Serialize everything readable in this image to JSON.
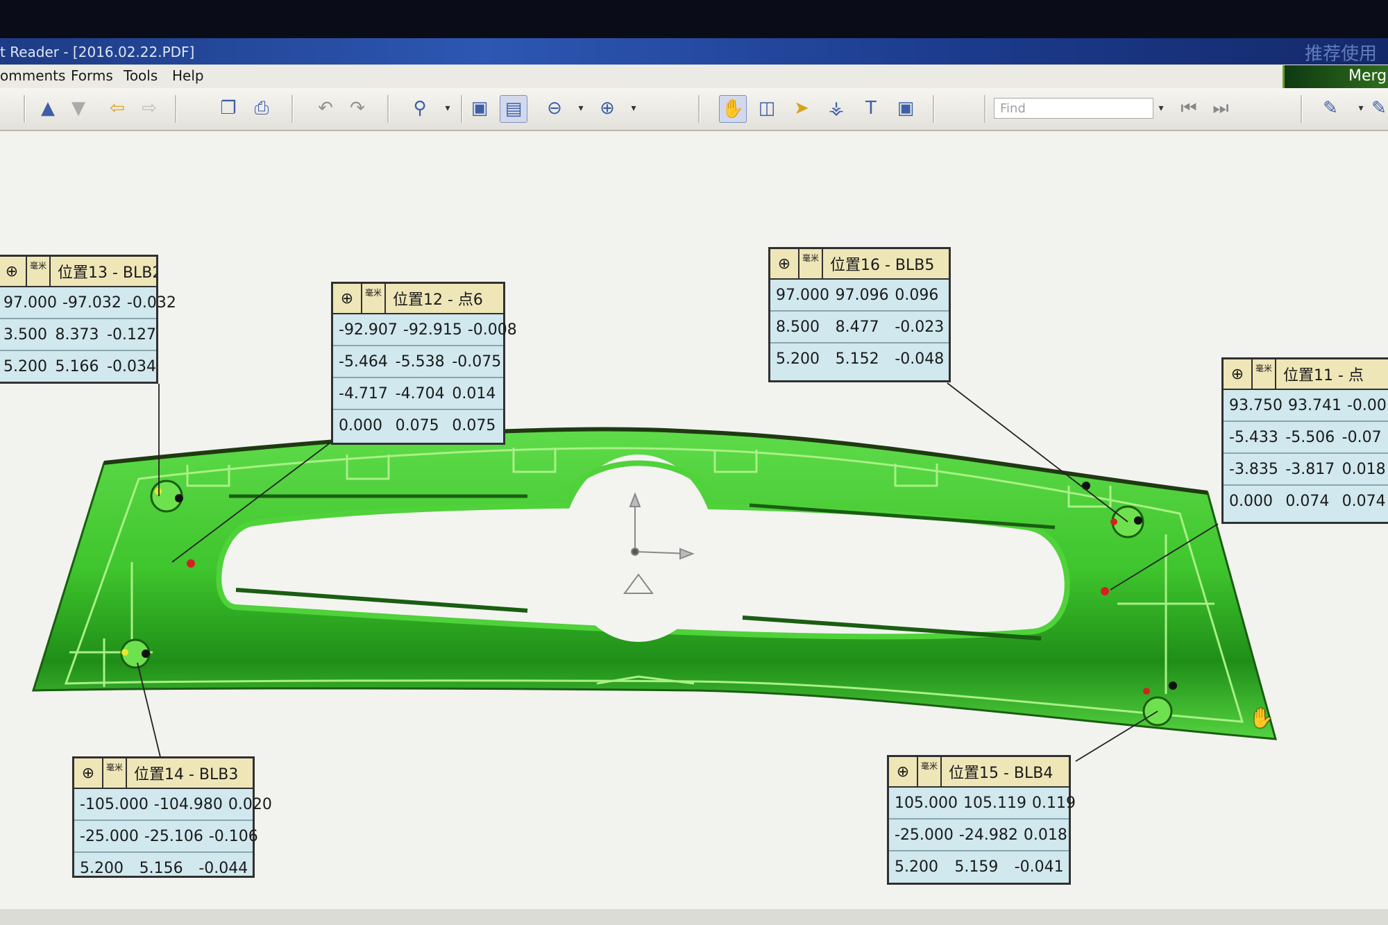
{
  "window": {
    "title": "t Reader - [2016.02.22.PDF]",
    "title_cjk": "推荐使用"
  },
  "menu": [
    "omments",
    "Forms",
    "Tools",
    "Help"
  ],
  "brand_tab": "Merg",
  "toolbar": {
    "find_placeholder": "Find",
    "icons": [
      "up-arrow-icon",
      "down-arrow-icon",
      "back-arrow-icon",
      "forward-arrow-icon",
      "save-copy-icon",
      "print-icon",
      "undo-icon",
      "redo-icon",
      "zoom-in-icon",
      "fit-page-icon",
      "actual-size-icon",
      "zoom-out-icon",
      "zoom-in-plus-icon",
      "hand-tool-icon",
      "select-text-icon",
      "pointer-icon",
      "binoculars-icon",
      "text-select-icon",
      "snapshot-icon",
      "prev-page-icon",
      "next-page-icon",
      "sign-icon"
    ]
  },
  "colors": {
    "part_green": "#3cc62e",
    "callout_bg": "#d0e8ee",
    "callout_header": "#efe6b8"
  },
  "callouts": [
    {
      "id": "pos13",
      "icon": "⊕",
      "unit": "毫米",
      "label": "位置13 - BLB2",
      "rows": [
        [
          "97.000",
          "-97.032",
          "-0.032"
        ],
        [
          "3.500",
          "8.373",
          "-0.127"
        ],
        [
          "5.200",
          "5.166",
          "-0.034"
        ]
      ]
    },
    {
      "id": "pos12",
      "icon": "⊕",
      "unit": "毫米",
      "label": "位置12 - 点6",
      "rows": [
        [
          "-92.907",
          "-92.915",
          "-0.008"
        ],
        [
          "-5.464",
          "-5.538",
          "-0.075"
        ],
        [
          "-4.717",
          "-4.704",
          "0.014"
        ],
        [
          "0.000",
          "0.075",
          "0.075"
        ]
      ]
    },
    {
      "id": "pos16",
      "icon": "⊕",
      "unit": "毫米",
      "label": "位置16 - BLB5",
      "rows": [
        [
          "97.000",
          "97.096",
          "0.096"
        ],
        [
          "8.500",
          "8.477",
          "-0.023"
        ],
        [
          "5.200",
          "5.152",
          "-0.048"
        ]
      ]
    },
    {
      "id": "pos11",
      "icon": "⊕",
      "unit": "毫米",
      "label": "位置11 - 点",
      "rows": [
        [
          "93.750",
          "93.741",
          "-0.00"
        ],
        [
          "-5.433",
          "-5.506",
          "-0.07"
        ],
        [
          "-3.835",
          "-3.817",
          "0.018"
        ],
        [
          "0.000",
          "0.074",
          "0.074"
        ]
      ]
    },
    {
      "id": "pos14",
      "icon": "⊕",
      "unit": "毫米",
      "label": "位置14 - BLB3",
      "rows": [
        [
          "-105.000",
          "-104.980",
          "0.020"
        ],
        [
          "-25.000",
          "-25.106",
          "-0.106"
        ],
        [
          "5.200",
          "5.156",
          "-0.044"
        ]
      ]
    },
    {
      "id": "pos15",
      "icon": "⊕",
      "unit": "毫米",
      "label": "位置15 - BLB4",
      "rows": [
        [
          "105.000",
          "105.119",
          "0.119"
        ],
        [
          "-25.000",
          "-24.982",
          "0.018"
        ],
        [
          "5.200",
          "5.159",
          "-0.041"
        ]
      ]
    }
  ]
}
